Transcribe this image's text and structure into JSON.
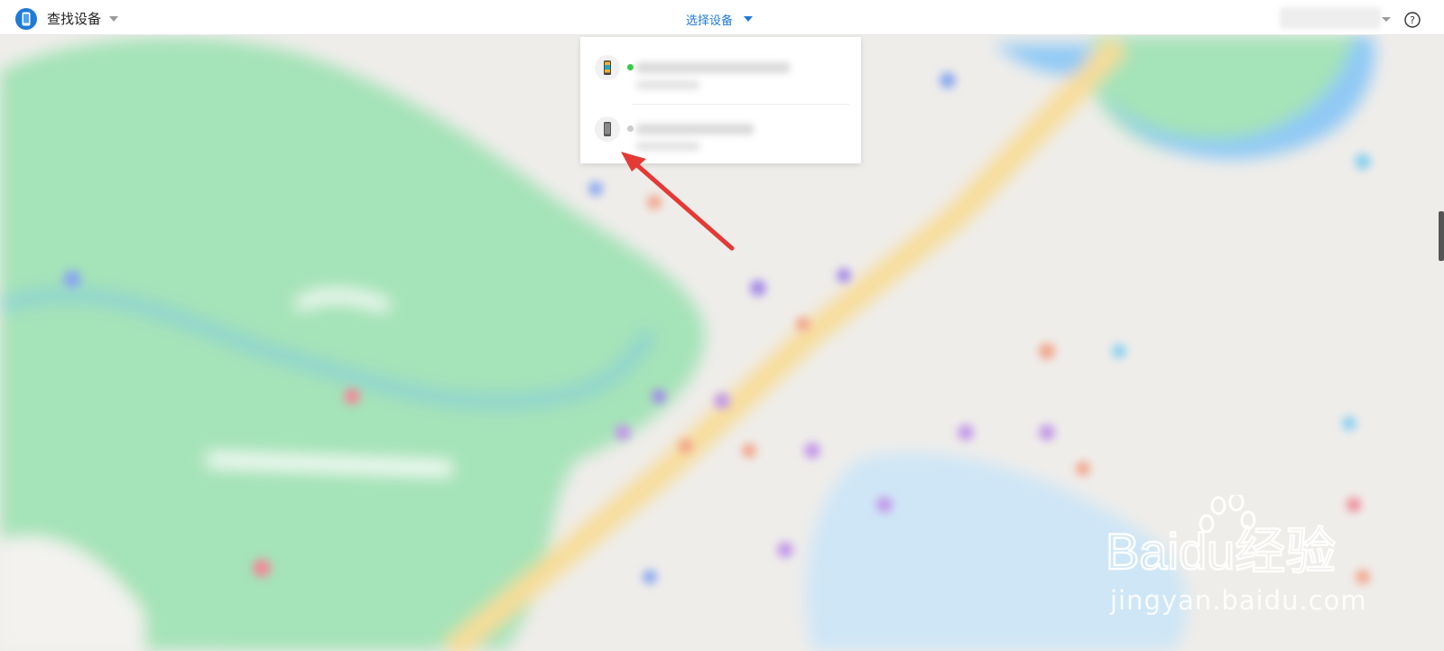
{
  "header": {
    "app_title": "查找设备",
    "select_device_label": "选择设备",
    "help_symbol": "?"
  },
  "dropdown": {
    "devices": [
      {
        "icon": "smartphone-color-icon",
        "status_color": "#2ecc40"
      },
      {
        "icon": "smartphone-gray-icon",
        "status_color": "#cccccc"
      }
    ]
  },
  "colors": {
    "accent": "#1f7ad8",
    "arrow": "#e53935"
  },
  "watermark": {
    "brand": "Baidu经验",
    "url": "jingyan.baidu.com"
  }
}
